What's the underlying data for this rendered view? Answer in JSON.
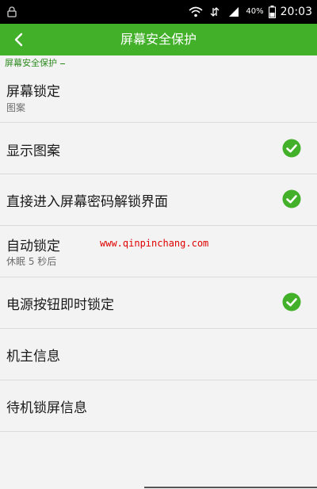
{
  "status_bar": {
    "battery_pct": "40%",
    "time": "20:03"
  },
  "app_bar": {
    "title": "屏幕安全保护"
  },
  "section": {
    "header": "屏幕安全保护"
  },
  "settings": {
    "items": [
      {
        "title": "屏幕锁定",
        "subtitle": "图案"
      },
      {
        "title": "显示图案",
        "checked": true
      },
      {
        "title": "直接进入屏幕密码解锁界面",
        "checked": true
      },
      {
        "title": "自动锁定",
        "subtitle": "休眠 5 秒后"
      },
      {
        "title": "电源按钮即时锁定",
        "checked": true
      },
      {
        "title": "机主信息"
      },
      {
        "title": "待机锁屏信息"
      }
    ]
  },
  "watermark": "www.qinpinchang.com",
  "colors": {
    "accent": "#43b02a",
    "status_bar": "#000000",
    "background": "#f3f3f3"
  },
  "icons": {
    "back": "chevron-left-icon",
    "check": "check-circle-icon"
  }
}
